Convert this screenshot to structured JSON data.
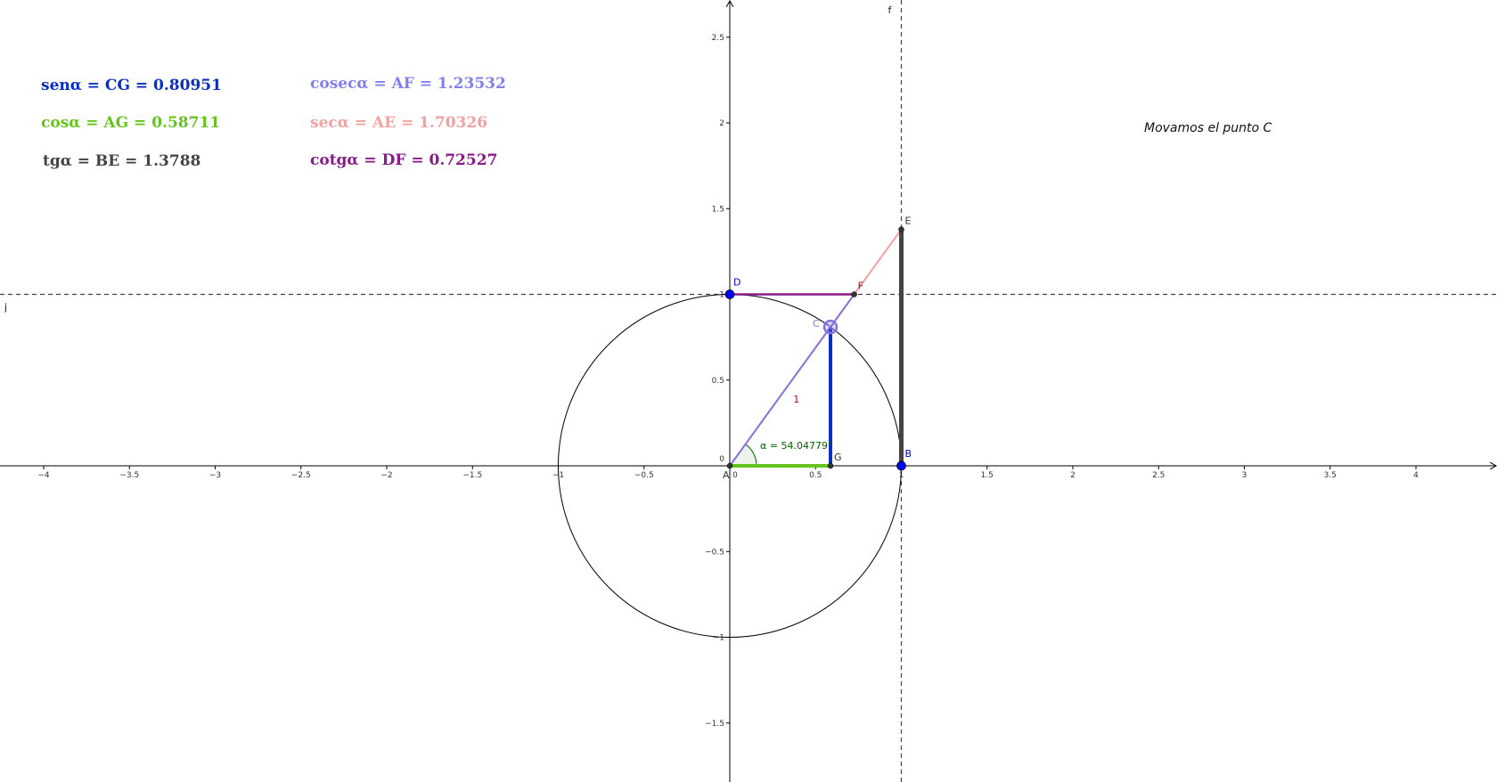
{
  "formulas": [
    {
      "id": "sen",
      "text": "senα = CG = 0.80951",
      "color": "#0a2fc4"
    },
    {
      "id": "cos",
      "text": "cosα = AG = 0.58711",
      "color": "#66c41e"
    },
    {
      "id": "tg",
      "text": "tgα = BE = 1.3788",
      "color": "#444444"
    },
    {
      "id": "cosec",
      "text": "cosecα = AF = 1.23532",
      "color": "#8080ee"
    },
    {
      "id": "sec",
      "text": "secα = AE = 1.70326",
      "color": "#f2a0a0"
    },
    {
      "id": "cotg",
      "text": "cotgα = DF = 0.72527",
      "color": "#8a1a8a"
    }
  ],
  "hint": "Movamos el punto C",
  "angle_label": "α = 54.04779°",
  "radius_label": "1",
  "line_labels": {
    "vertical": "f",
    "horizontal": "j"
  },
  "points": {
    "A": {
      "label": "A",
      "x": 0,
      "y": 0
    },
    "B": {
      "label": "B",
      "x": 1,
      "y": 0
    },
    "C": {
      "label": "C",
      "x": 0.58711,
      "y": 0.80951
    },
    "D": {
      "label": "D",
      "x": 0,
      "y": 1
    },
    "E": {
      "label": "E",
      "x": 1,
      "y": 1.3788
    },
    "F": {
      "label": "F",
      "x": 0.72527,
      "y": 1
    },
    "G": {
      "label": "G",
      "x": 0.58711,
      "y": 0
    }
  },
  "axes": {
    "x_ticks": [
      "-4",
      "-3.5",
      "-3",
      "-2.5",
      "-2",
      "-1.5",
      "-1",
      "-0.5",
      "0",
      "0.5",
      "1",
      "1.5",
      "2",
      "2.5",
      "3",
      "3.5",
      "4"
    ],
    "y_ticks": [
      "-1.5",
      "-1",
      "-0.5",
      "0",
      "0.5",
      "1",
      "1.5",
      "2",
      "2.5"
    ]
  },
  "colors": {
    "sin": "#0a2fc4",
    "cos": "#66c41e",
    "tan": "#444444",
    "radius": "#8a73e0",
    "sec": "#f2a0a0",
    "cotg": "#8a1a8a",
    "point_blue": "#0000ff",
    "point_dark": "#333333",
    "angle": "#006400",
    "radius_label": "#cc0000"
  }
}
